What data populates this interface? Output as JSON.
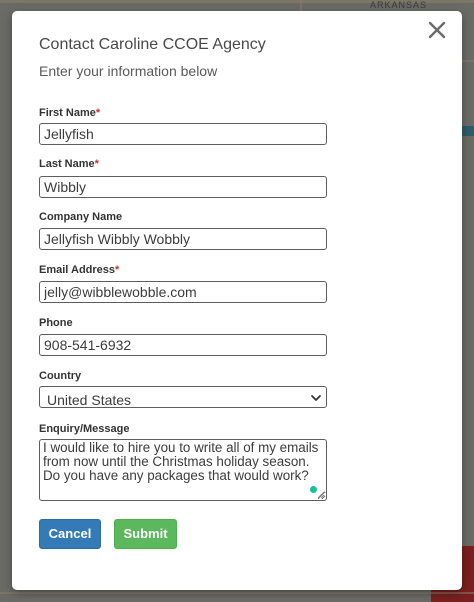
{
  "backdrop": {
    "map_label": "ARKANSAS"
  },
  "modal": {
    "title": "Contact Caroline CCOE Agency",
    "subtitle": "Enter your information below",
    "close_icon": "close-icon",
    "required_marker": "*",
    "fields": {
      "first_name": {
        "label": "First Name",
        "required": true,
        "value": "Jellyfish"
      },
      "last_name": {
        "label": "Last Name",
        "required": true,
        "value": "Wibbly"
      },
      "company_name": {
        "label": "Company Name",
        "required": false,
        "value": "Jellyfish Wibbly Wobbly"
      },
      "email": {
        "label": "Email Address",
        "required": true,
        "value": "jelly@wibblewobble.com"
      },
      "phone": {
        "label": "Phone",
        "required": false,
        "value": "908-541-6932"
      },
      "country": {
        "label": "Country",
        "required": false,
        "value": "United States"
      },
      "message": {
        "label": "Enquiry/Message",
        "required": false,
        "value": "I would like to hire you to write all of my emails from now until the Christmas holiday season. Do you have any packages that would work?"
      }
    },
    "buttons": {
      "cancel": "Cancel",
      "submit": "Submit"
    },
    "colors": {
      "cancel_bg": "#337ab7",
      "submit_bg": "#5cb85c",
      "required": "#c9302c",
      "grammar_dot": "#15c39a"
    }
  }
}
